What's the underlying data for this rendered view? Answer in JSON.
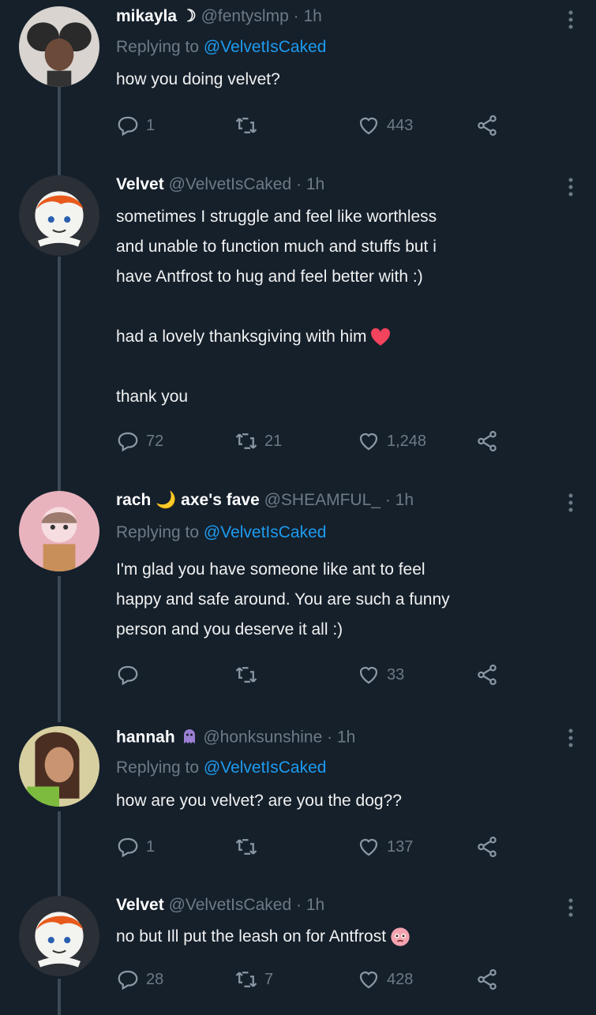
{
  "tweets": [
    {
      "name": "mikayla ☽",
      "handle": "@fentyslmp",
      "time": "1h",
      "replying_prefix": "Replying to",
      "replying_mention": "@VelvetIsCaked",
      "lines": [
        "how you doing velvet?"
      ],
      "counts": {
        "reply": "1",
        "retweet": "",
        "like": "443"
      },
      "avatar": "avatar-mikayla"
    },
    {
      "name": "Velvet",
      "handle": "@VelvetIsCaked",
      "time": "1h",
      "lines": [
        "sometimes I struggle and feel like worthless",
        "and unable to function much and stuffs but i",
        "have Antfrost to hug and feel better with :)",
        "",
        "had a lovely thanksgiving with him",
        "",
        "thank you"
      ],
      "counts": {
        "reply": "72",
        "retweet": "21",
        "like": "1,248"
      },
      "avatar": "avatar-velvet"
    },
    {
      "name": "rach 🌙 axe's fave",
      "handle": "@SHEAMFUL_",
      "time": "1h",
      "replying_prefix": "Replying to",
      "replying_mention": "@VelvetIsCaked",
      "lines": [
        "I'm glad you have someone like ant to feel",
        "happy and safe around. You are such a funny",
        "person and you deserve it all :)"
      ],
      "counts": {
        "reply": "",
        "retweet": "",
        "like": "33"
      },
      "avatar": "avatar-rach"
    },
    {
      "name": "hannah",
      "handle": "@honksunshine",
      "time": "1h",
      "replying_prefix": "Replying to",
      "replying_mention": "@VelvetIsCaked",
      "lines": [
        "how are you velvet? are you the dog??"
      ],
      "counts": {
        "reply": "1",
        "retweet": "",
        "like": "137"
      },
      "avatar": "avatar-hannah"
    },
    {
      "name": "Velvet",
      "handle": "@VelvetIsCaked",
      "time": "1h",
      "lines": [
        "no but Ill put the leash on for Antfrost"
      ],
      "counts": {
        "reply": "28",
        "retweet": "7",
        "like": "428"
      },
      "avatar": "avatar-velvet"
    }
  ],
  "icons": {
    "reply": "reply-icon",
    "retweet": "retweet-icon",
    "like": "heart-icon",
    "share": "share-icon",
    "more": "more-icon"
  },
  "colors": {
    "background": "#15202b",
    "mention": "#1d9bf0",
    "muted": "#6e7a86",
    "heart_emoji": "#f4435c"
  }
}
